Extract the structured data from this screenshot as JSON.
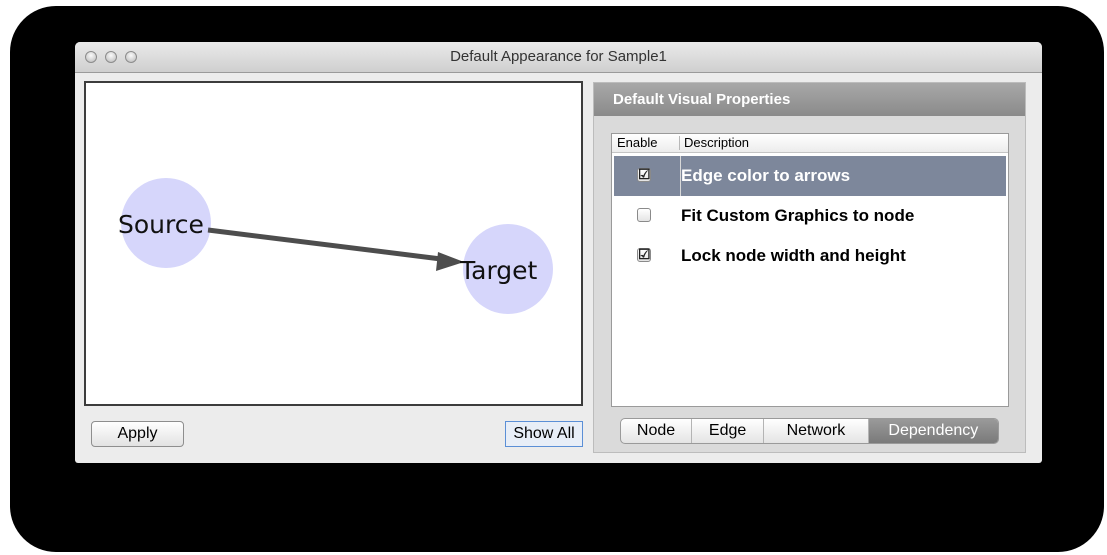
{
  "window": {
    "title": "Default Appearance for Sample1"
  },
  "graph": {
    "source_label": "Source",
    "target_label": "Target",
    "node_color": "#d6d6fb",
    "edge_color": "#4d4d4d"
  },
  "buttons": {
    "apply": "Apply",
    "show_all": "Show All"
  },
  "panel": {
    "header": "Default Visual Properties",
    "columns": {
      "enable": "Enable",
      "description": "Description"
    },
    "rows": [
      {
        "label": "Edge color to arrows",
        "checked": true,
        "selected": true,
        "mark": "☑"
      },
      {
        "label": "Fit Custom Graphics to node",
        "checked": false,
        "selected": false,
        "mark": ""
      },
      {
        "label": "Lock node width and height",
        "checked": true,
        "selected": false,
        "mark": "☑"
      }
    ],
    "tabs": [
      {
        "label": "Node",
        "active": false
      },
      {
        "label": "Edge",
        "active": false
      },
      {
        "label": "Network",
        "active": false
      },
      {
        "label": "Dependency",
        "active": true
      }
    ]
  }
}
